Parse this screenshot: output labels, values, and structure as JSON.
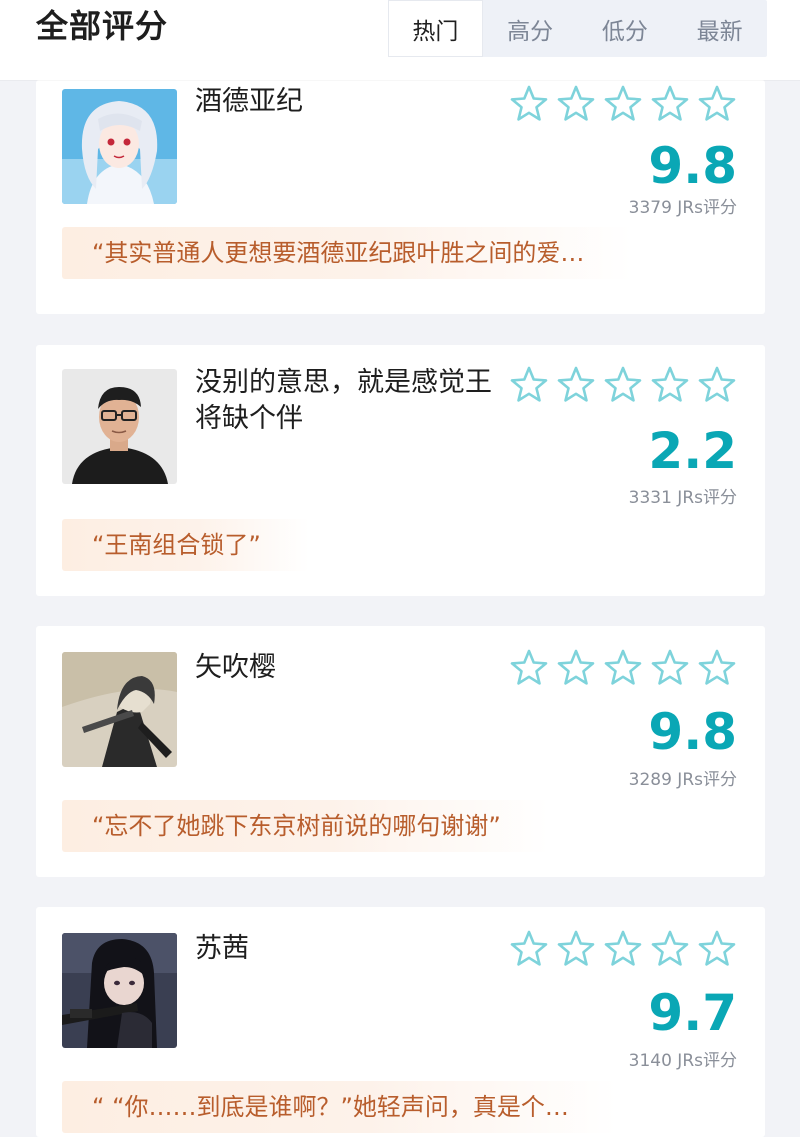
{
  "header": {
    "title": "全部评分",
    "tabs": [
      {
        "label": "热门",
        "active": true
      },
      {
        "label": "高分",
        "active": false
      },
      {
        "label": "低分",
        "active": false
      },
      {
        "label": "最新",
        "active": false
      }
    ]
  },
  "colors": {
    "score": "#0aa7b5",
    "star_outline": "#7ed3db",
    "quote_text": "#b85d2c",
    "quote_bg": "#fdeee2"
  },
  "cards": [
    {
      "name": "酒德亚纪",
      "score": "9.8",
      "count": "3379 JRs评分",
      "quote": "“其实普通人更想要酒德亚纪跟叶胜之间的爱…",
      "avatar": "anime-girl-avatar"
    },
    {
      "name": "没别的意思，就是感觉王将缺个伴",
      "score": "2.2",
      "count": "3331 JRs评分",
      "quote": "“王南组合锁了”",
      "avatar": "man-with-glasses-avatar"
    },
    {
      "name": "矢吹樱",
      "score": "9.8",
      "count": "3289 JRs评分",
      "quote": "“忘不了她跳下东京树前说的哪句谢谢”",
      "avatar": "sketch-girl-avatar"
    },
    {
      "name": "苏茜",
      "score": "9.7",
      "count": "3140 JRs评分",
      "quote": "“  “你……到底是谁啊？”她轻声问，真是个…",
      "avatar": "sniper-girl-avatar"
    }
  ]
}
